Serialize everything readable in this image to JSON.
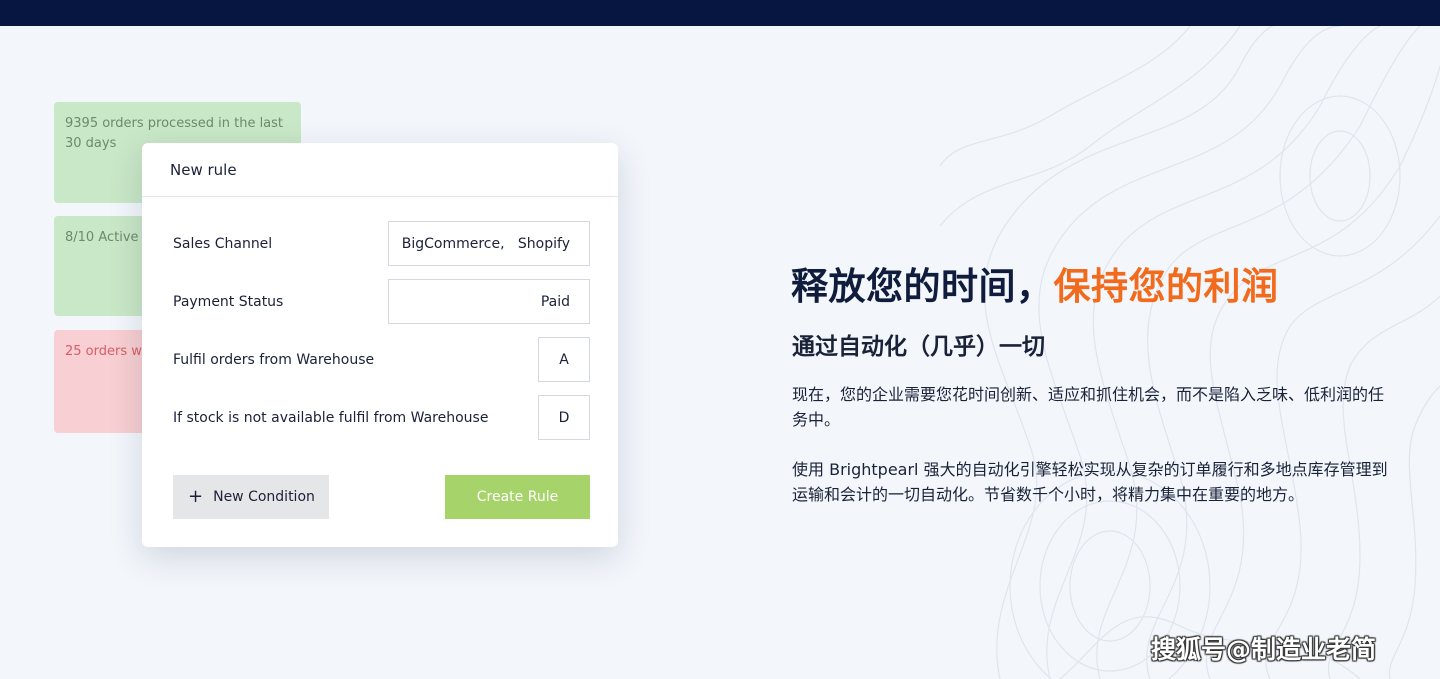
{
  "stats": [
    {
      "text": "9395 orders processed in the last 30 days"
    },
    {
      "text": "8/10 Active rules"
    },
    {
      "text": "25 orders with errors in the last"
    }
  ],
  "modal": {
    "title": "New rule",
    "rows": [
      {
        "label": "Sales Channel",
        "value": "BigCommerce,   Shopify"
      },
      {
        "label": "Payment Status",
        "value": "Paid"
      },
      {
        "label": "Fulfil orders from Warehouse",
        "value": "A"
      },
      {
        "label": "If stock is not available fulfil from Warehouse",
        "value": "D"
      }
    ],
    "new_condition_label": "New Condition",
    "create_rule_label": "Create Rule"
  },
  "hero": {
    "headline_main": "释放您的时间，",
    "headline_accent": "保持您的利润",
    "subheading": "通过自动化（几乎）一切",
    "paragraph1": "现在，您的企业需要您花时间创新、适应和抓住机会，而不是陷入乏味、低利润的任务中。",
    "paragraph2": "使用 Brightpearl 强大的自动化引擎轻松实现从复杂的订单履行和多地点库存管理到运输和会计的一切自动化。节省数千个小时，将精力集中在重要的地方。"
  },
  "watermark": "搜狐号@制造业老简",
  "colors": {
    "top_bar": "#061640",
    "accent": "#f26a1b",
    "create_button": "#a6d46a",
    "stat_green": "#c9e8c7",
    "stat_red": "#f8cfd2"
  }
}
